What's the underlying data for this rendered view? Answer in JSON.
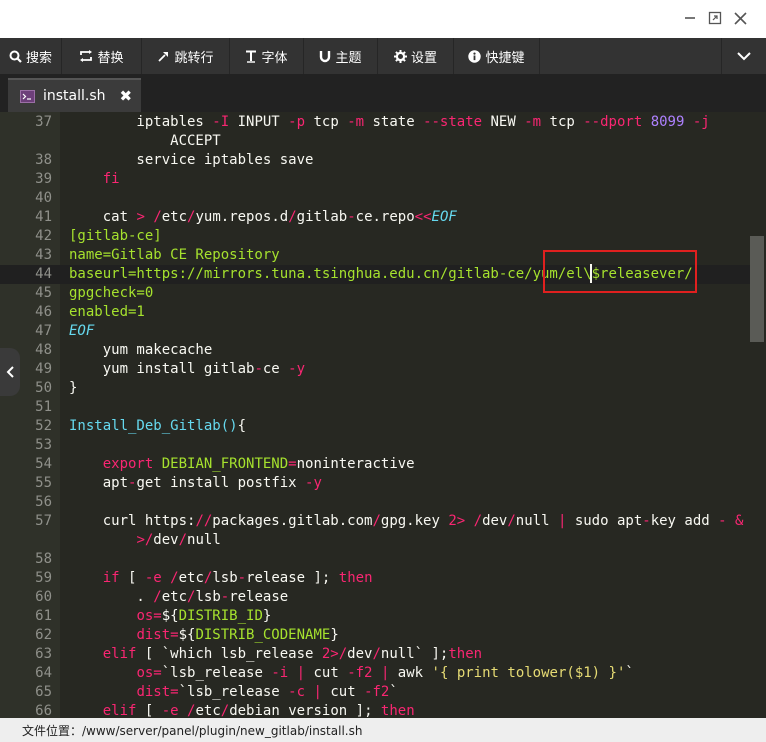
{
  "toolbar": {
    "items": [
      {
        "label": "搜索",
        "icon": "search-icon"
      },
      {
        "label": "替换",
        "icon": "replace-icon"
      },
      {
        "label": "跳转行",
        "icon": "jump-icon"
      },
      {
        "label": "字体",
        "icon": "font-icon"
      },
      {
        "label": "主题",
        "icon": "theme-icon"
      },
      {
        "label": "设置",
        "icon": "gear-icon"
      },
      {
        "label": "快捷键",
        "icon": "info-icon"
      }
    ]
  },
  "tab": {
    "label": "install.sh",
    "icon": "terminal-file-icon"
  },
  "editor": {
    "lines": [
      {
        "num": "37",
        "tokens": [
          {
            "c": "w",
            "t": "        iptables "
          },
          {
            "c": "p",
            "t": "-I"
          },
          {
            "c": "w",
            "t": " INPUT "
          },
          {
            "c": "p",
            "t": "-p"
          },
          {
            "c": "w",
            "t": " tcp "
          },
          {
            "c": "p",
            "t": "-m"
          },
          {
            "c": "w",
            "t": " state "
          },
          {
            "c": "p",
            "t": "--state"
          },
          {
            "c": "w",
            "t": " NEW "
          },
          {
            "c": "p",
            "t": "-m"
          },
          {
            "c": "w",
            "t": " tcp "
          },
          {
            "c": "p",
            "t": "--dport"
          },
          {
            "c": "w",
            "t": " "
          },
          {
            "c": "v",
            "t": "8099"
          },
          {
            "c": "w",
            "t": " "
          },
          {
            "c": "p",
            "t": "-j"
          }
        ]
      },
      {
        "num": "",
        "tokens": [
          {
            "c": "w",
            "t": "            ACCEPT"
          }
        ]
      },
      {
        "num": "38",
        "tokens": [
          {
            "c": "w",
            "t": "        service iptables save"
          }
        ]
      },
      {
        "num": "39",
        "tokens": [
          {
            "c": "w",
            "t": "    "
          },
          {
            "c": "p",
            "t": "fi"
          }
        ]
      },
      {
        "num": "40",
        "tokens": []
      },
      {
        "num": "41",
        "tokens": [
          {
            "c": "w",
            "t": "    cat "
          },
          {
            "c": "p",
            "t": ">"
          },
          {
            "c": "w",
            "t": " "
          },
          {
            "c": "p",
            "t": "/"
          },
          {
            "c": "w",
            "t": "etc"
          },
          {
            "c": "p",
            "t": "/"
          },
          {
            "c": "w",
            "t": "yum.repos.d"
          },
          {
            "c": "p",
            "t": "/"
          },
          {
            "c": "w",
            "t": "gitlab"
          },
          {
            "c": "p",
            "t": "-"
          },
          {
            "c": "w",
            "t": "ce.repo"
          },
          {
            "c": "p",
            "t": "<<"
          },
          {
            "c": "ci",
            "t": "EOF"
          }
        ]
      },
      {
        "num": "42",
        "tokens": [
          {
            "c": "g",
            "t": "[gitlab-ce]"
          }
        ]
      },
      {
        "num": "43",
        "tokens": [
          {
            "c": "g",
            "t": "name=Gitlab CE Repository"
          }
        ]
      },
      {
        "num": "44",
        "active": true,
        "tokens": [
          {
            "c": "g",
            "t": "baseurl=https://mirrors.tuna.tsinghua.edu.cn/gitlab-ce/yum/el\\$releasever/"
          }
        ]
      },
      {
        "num": "45",
        "tokens": [
          {
            "c": "g",
            "t": "gpgcheck=0"
          }
        ]
      },
      {
        "num": "46",
        "tokens": [
          {
            "c": "g",
            "t": "enabled=1"
          }
        ]
      },
      {
        "num": "47",
        "tokens": [
          {
            "c": "ci",
            "t": "EOF"
          }
        ]
      },
      {
        "num": "48",
        "tokens": [
          {
            "c": "w",
            "t": "    yum makecache"
          }
        ]
      },
      {
        "num": "49",
        "tokens": [
          {
            "c": "w",
            "t": "    yum install gitlab"
          },
          {
            "c": "p",
            "t": "-"
          },
          {
            "c": "w",
            "t": "ce "
          },
          {
            "c": "p",
            "t": "-y"
          }
        ]
      },
      {
        "num": "50",
        "tokens": [
          {
            "c": "w",
            "t": "}"
          }
        ]
      },
      {
        "num": "51",
        "tokens": []
      },
      {
        "num": "52",
        "tokens": [
          {
            "c": "c",
            "t": "Install_Deb_Gitlab()"
          },
          {
            "c": "w",
            "t": "{"
          }
        ]
      },
      {
        "num": "53",
        "tokens": []
      },
      {
        "num": "54",
        "tokens": [
          {
            "c": "w",
            "t": "    "
          },
          {
            "c": "p",
            "t": "export"
          },
          {
            "c": "w",
            "t": " "
          },
          {
            "c": "g",
            "t": "DEBIAN_FRONTEND"
          },
          {
            "c": "p",
            "t": "="
          },
          {
            "c": "w",
            "t": "noninteractive"
          }
        ]
      },
      {
        "num": "55",
        "tokens": [
          {
            "c": "w",
            "t": "    apt"
          },
          {
            "c": "p",
            "t": "-"
          },
          {
            "c": "w",
            "t": "get install postfix "
          },
          {
            "c": "p",
            "t": "-y"
          }
        ]
      },
      {
        "num": "56",
        "tokens": []
      },
      {
        "num": "57",
        "tokens": [
          {
            "c": "w",
            "t": "    curl https:"
          },
          {
            "c": "p",
            "t": "//"
          },
          {
            "c": "w",
            "t": "packages.gitlab.com"
          },
          {
            "c": "p",
            "t": "/"
          },
          {
            "c": "w",
            "t": "gpg.key "
          },
          {
            "c": "p",
            "t": "2>"
          },
          {
            "c": "w",
            "t": " "
          },
          {
            "c": "p",
            "t": "/"
          },
          {
            "c": "w",
            "t": "dev"
          },
          {
            "c": "p",
            "t": "/"
          },
          {
            "c": "w",
            "t": "null "
          },
          {
            "c": "p",
            "t": "|"
          },
          {
            "c": "w",
            "t": " sudo apt"
          },
          {
            "c": "p",
            "t": "-"
          },
          {
            "c": "w",
            "t": "key add "
          },
          {
            "c": "p",
            "t": "-"
          },
          {
            "c": "w",
            "t": " "
          },
          {
            "c": "p",
            "t": "&"
          }
        ]
      },
      {
        "num": "",
        "tokens": [
          {
            "c": "w",
            "t": "        "
          },
          {
            "c": "p",
            "t": ">/"
          },
          {
            "c": "w",
            "t": "dev"
          },
          {
            "c": "p",
            "t": "/"
          },
          {
            "c": "w",
            "t": "null"
          }
        ]
      },
      {
        "num": "58",
        "tokens": []
      },
      {
        "num": "59",
        "tokens": [
          {
            "c": "w",
            "t": "    "
          },
          {
            "c": "p",
            "t": "if"
          },
          {
            "c": "w",
            "t": " [ "
          },
          {
            "c": "p",
            "t": "-e"
          },
          {
            "c": "w",
            "t": " "
          },
          {
            "c": "p",
            "t": "/"
          },
          {
            "c": "w",
            "t": "etc"
          },
          {
            "c": "p",
            "t": "/"
          },
          {
            "c": "w",
            "t": "lsb"
          },
          {
            "c": "p",
            "t": "-"
          },
          {
            "c": "w",
            "t": "release ]; "
          },
          {
            "c": "p",
            "t": "then"
          }
        ]
      },
      {
        "num": "60",
        "tokens": [
          {
            "c": "w",
            "t": "        . "
          },
          {
            "c": "p",
            "t": "/"
          },
          {
            "c": "w",
            "t": "etc"
          },
          {
            "c": "p",
            "t": "/"
          },
          {
            "c": "w",
            "t": "lsb"
          },
          {
            "c": "p",
            "t": "-"
          },
          {
            "c": "w",
            "t": "release"
          }
        ]
      },
      {
        "num": "61",
        "tokens": [
          {
            "c": "w",
            "t": "        "
          },
          {
            "c": "p",
            "t": "os="
          },
          {
            "c": "w",
            "t": "${"
          },
          {
            "c": "g",
            "t": "DISTRIB_ID"
          },
          {
            "c": "w",
            "t": "}"
          }
        ]
      },
      {
        "num": "62",
        "tokens": [
          {
            "c": "w",
            "t": "        "
          },
          {
            "c": "p",
            "t": "dist="
          },
          {
            "c": "w",
            "t": "${"
          },
          {
            "c": "g",
            "t": "DISTRIB_CODENAME"
          },
          {
            "c": "w",
            "t": "}"
          }
        ]
      },
      {
        "num": "63",
        "tokens": [
          {
            "c": "w",
            "t": "    "
          },
          {
            "c": "p",
            "t": "elif"
          },
          {
            "c": "w",
            "t": " [ `which lsb_release "
          },
          {
            "c": "p",
            "t": "2>/"
          },
          {
            "c": "w",
            "t": "dev"
          },
          {
            "c": "p",
            "t": "/"
          },
          {
            "c": "w",
            "t": "null` ];"
          },
          {
            "c": "p",
            "t": "then"
          }
        ]
      },
      {
        "num": "64",
        "tokens": [
          {
            "c": "w",
            "t": "        "
          },
          {
            "c": "p",
            "t": "os="
          },
          {
            "c": "w",
            "t": "`lsb_release "
          },
          {
            "c": "p",
            "t": "-i"
          },
          {
            "c": "w",
            "t": " "
          },
          {
            "c": "p",
            "t": "|"
          },
          {
            "c": "w",
            "t": " cut "
          },
          {
            "c": "p",
            "t": "-f2"
          },
          {
            "c": "w",
            "t": " "
          },
          {
            "c": "p",
            "t": "|"
          },
          {
            "c": "w",
            "t": " awk "
          },
          {
            "c": "y",
            "t": "'{ print tolower($1) }'"
          },
          {
            "c": "w",
            "t": "`"
          }
        ]
      },
      {
        "num": "65",
        "tokens": [
          {
            "c": "w",
            "t": "        "
          },
          {
            "c": "p",
            "t": "dist="
          },
          {
            "c": "w",
            "t": "`lsb_release "
          },
          {
            "c": "p",
            "t": "-c"
          },
          {
            "c": "w",
            "t": " "
          },
          {
            "c": "p",
            "t": "|"
          },
          {
            "c": "w",
            "t": " cut "
          },
          {
            "c": "p",
            "t": "-f2"
          },
          {
            "c": "w",
            "t": "`"
          }
        ]
      },
      {
        "num": "66",
        "tokens": [
          {
            "c": "w",
            "t": "    "
          },
          {
            "c": "p",
            "t": "elif"
          },
          {
            "c": "w",
            "t": " [ "
          },
          {
            "c": "p",
            "t": "-e"
          },
          {
            "c": "w",
            "t": " "
          },
          {
            "c": "p",
            "t": "/"
          },
          {
            "c": "w",
            "t": "etc"
          },
          {
            "c": "p",
            "t": "/"
          },
          {
            "c": "w",
            "t": "debian_version ]; "
          },
          {
            "c": "p",
            "t": "then"
          }
        ]
      }
    ]
  },
  "status": {
    "text": "文件位置：/www/server/panel/plugin/new_gitlab/install.sh"
  }
}
